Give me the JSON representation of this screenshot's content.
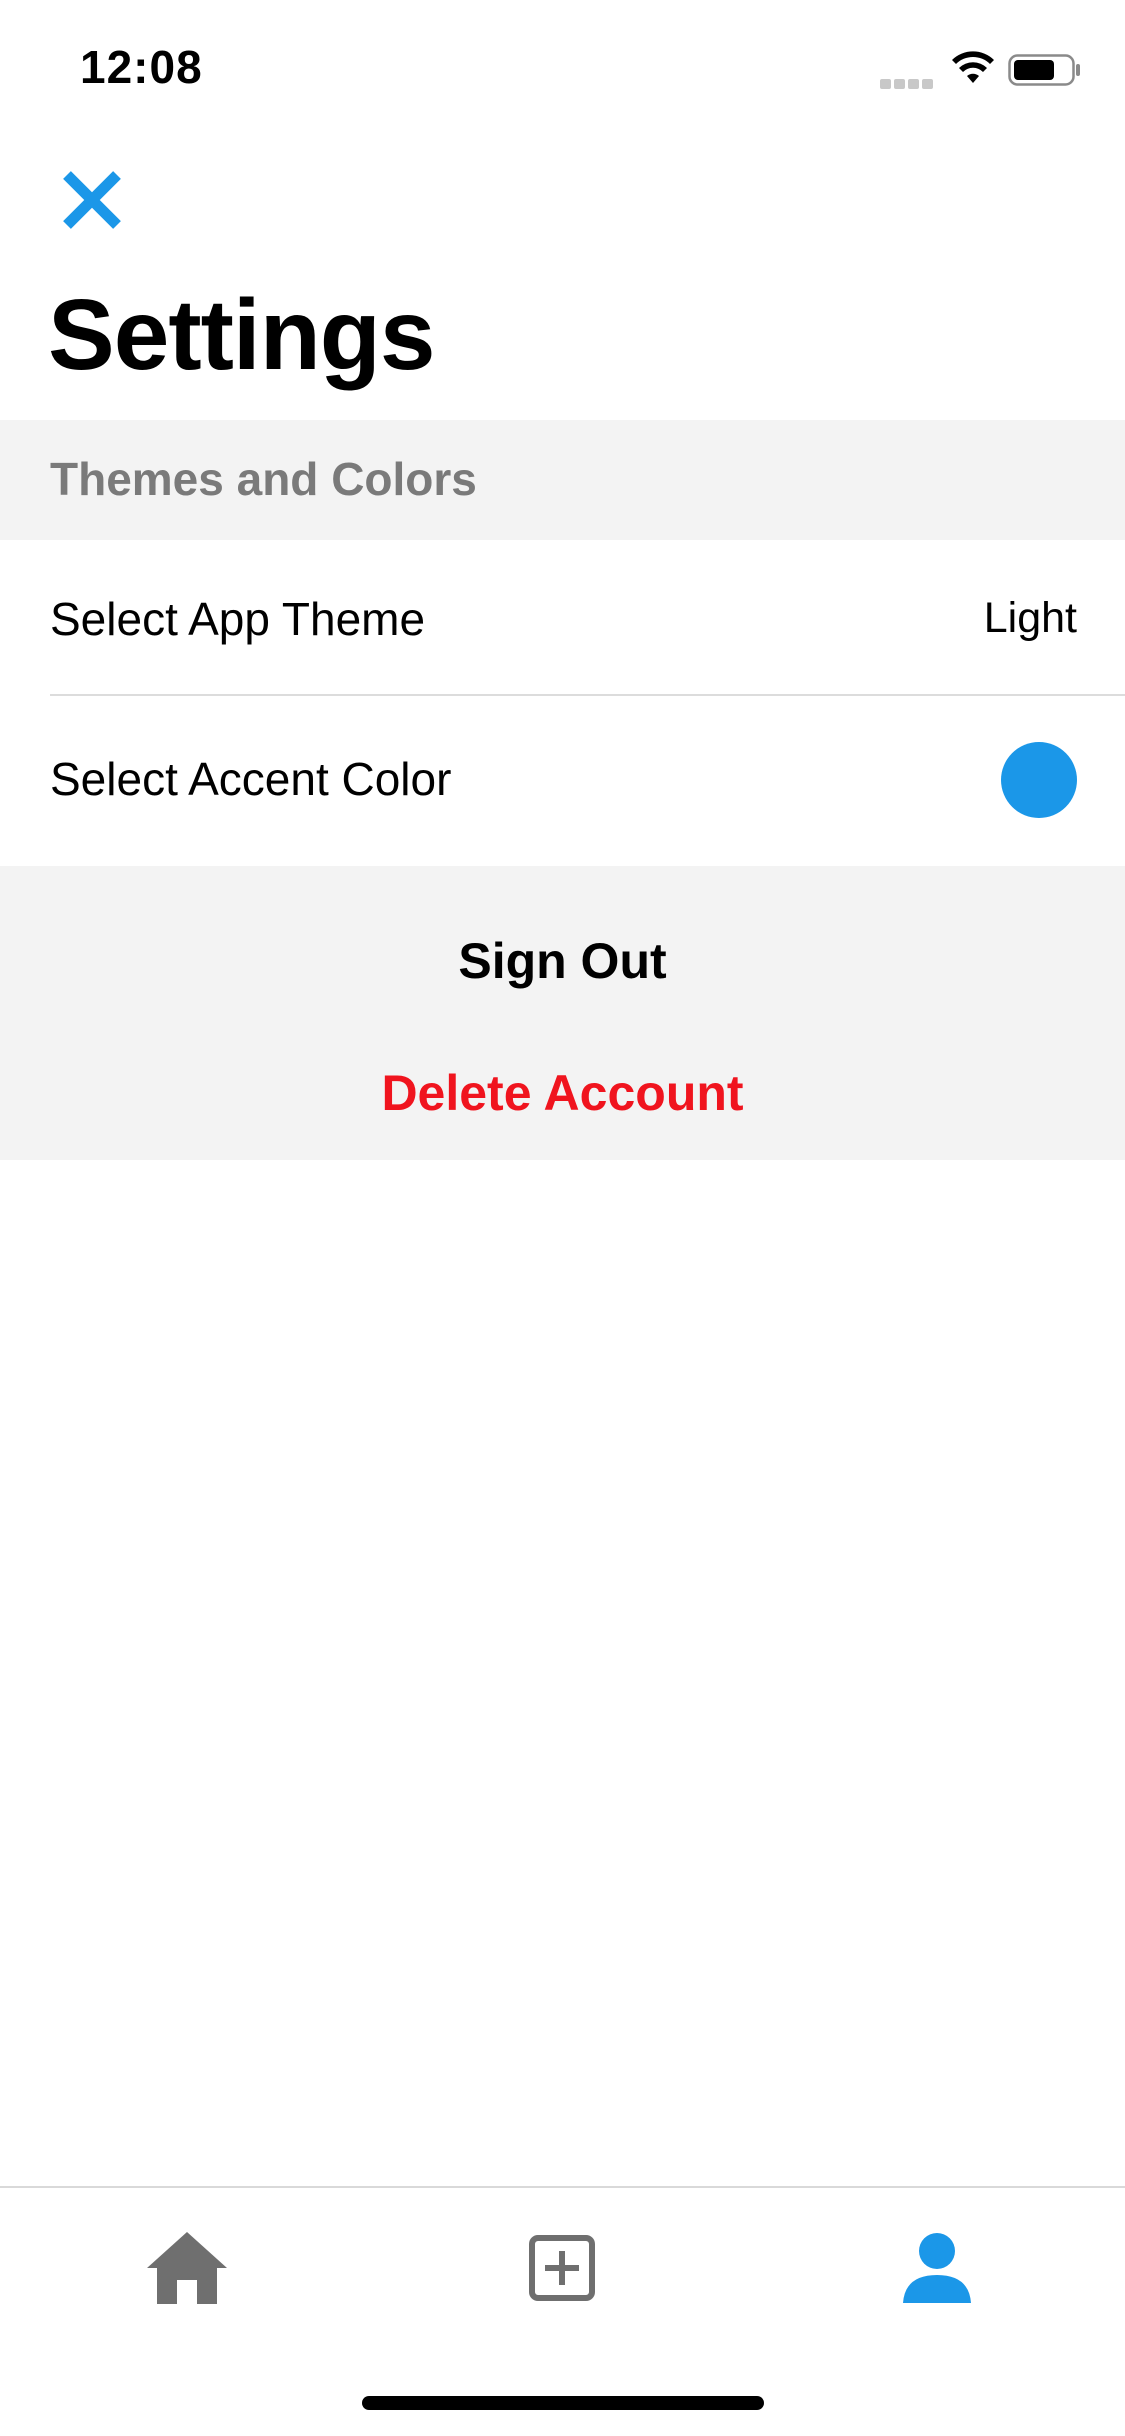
{
  "status_bar": {
    "time": "12:08"
  },
  "header": {
    "close_icon": "close-icon",
    "title": "Settings"
  },
  "section": {
    "title": "Themes and Colors"
  },
  "rows": {
    "theme": {
      "label": "Select App Theme",
      "value": "Light"
    },
    "accent": {
      "label": "Select Accent Color",
      "color": "#1b97e8"
    }
  },
  "actions": {
    "sign_out": "Sign Out",
    "delete_account": "Delete Account",
    "delete_color": "#f0141e"
  },
  "tab_bar": {
    "tabs": [
      {
        "icon": "home-icon",
        "active": false
      },
      {
        "icon": "add-square-icon",
        "active": false
      },
      {
        "icon": "profile-icon",
        "active": true
      }
    ],
    "active_color": "#1b97e8",
    "inactive_color": "#6f6f6f"
  },
  "colors": {
    "accent": "#1b97e8",
    "section_background": "#f3f3f3",
    "section_text": "#7a7a7a"
  }
}
